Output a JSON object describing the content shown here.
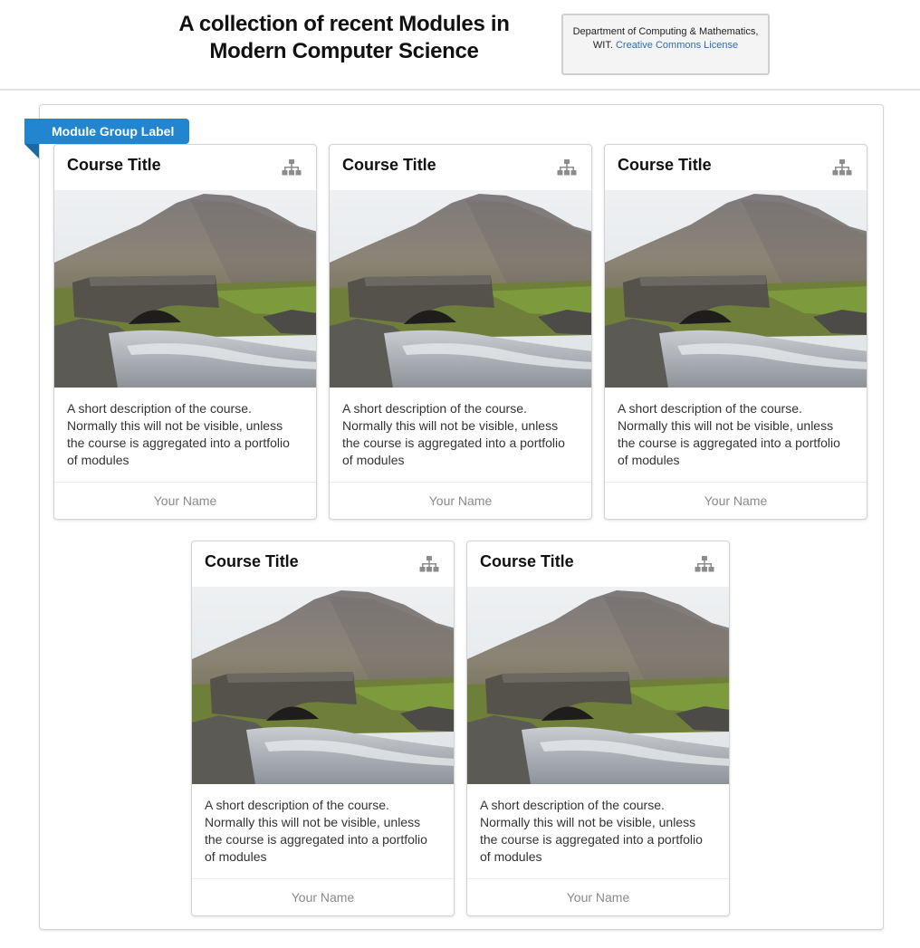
{
  "header": {
    "title": "A collection of recent Modules in Modern Computer Science",
    "credit_text": "Department of Computing & Mathematics, WIT.",
    "credit_link": "Creative Commons License"
  },
  "group": {
    "label": "Module Group Label"
  },
  "cards": [
    {
      "title": "Course Title",
      "icon": "sitemap-icon",
      "description": "A short description of the course. Normally this will not be visible, unless the course is aggregated into a portfolio of modules",
      "author": "Your Name"
    },
    {
      "title": "Course Title",
      "icon": "sitemap-icon",
      "description": "A short description of the course. Normally this will not be visible, unless the course is aggregated into a portfolio of modules",
      "author": "Your Name"
    },
    {
      "title": "Course Title",
      "icon": "sitemap-icon",
      "description": "A short description of the course. Normally this will not be visible, unless the course is aggregated into a portfolio of modules",
      "author": "Your Name"
    },
    {
      "title": "Course Title",
      "icon": "sitemap-icon",
      "description": "A short description of the course. Normally this will not be visible, unless the course is aggregated into a portfolio of modules",
      "author": "Your Name"
    },
    {
      "title": "Course Title",
      "icon": "sitemap-icon",
      "description": "A short description of the course. Normally this will not be visible, unless the course is aggregated into a portfolio of modules",
      "author": "Your Name"
    }
  ],
  "colors": {
    "ribbon": "#2185d0",
    "link": "#2a6fb8"
  }
}
